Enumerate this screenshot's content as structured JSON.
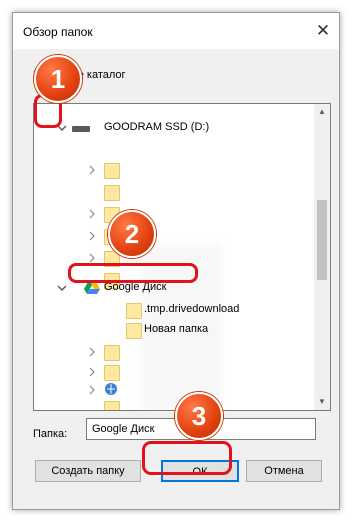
{
  "dialog": {
    "title": "Обзор папок",
    "close_glyph": "✕",
    "instruction": "Выберите каталог"
  },
  "tree": {
    "drive_label": "GOODRAM SSD (D:)",
    "gdrive_label": "Google Диск",
    "children": [
      ".tmp.drivedownload",
      "Новая папка"
    ]
  },
  "folder_field": {
    "label": "Папка:",
    "value": "Google Диск"
  },
  "buttons": {
    "new_folder": "Создать папку",
    "ok": "ОК",
    "cancel": "Отмена"
  },
  "annotations": {
    "step1": "1",
    "step2": "2",
    "step3": "3"
  },
  "colors": {
    "highlight": "#e0131a",
    "accent": "#0078d7",
    "badge": "#e2400f"
  },
  "icons": {
    "drive": "drive-icon",
    "gdrive": "google-drive-icon",
    "folder": "folder-icon",
    "chevron_collapsed": "chevron-right-icon",
    "chevron_expanded": "chevron-down-icon"
  }
}
